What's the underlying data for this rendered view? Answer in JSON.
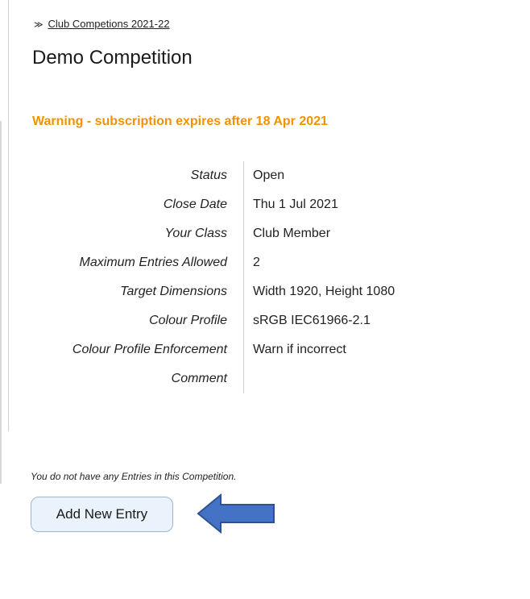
{
  "breadcrumb": {
    "chevron": "≫",
    "link_label": "Club Competions 2021-22"
  },
  "page_title": "Demo Competition",
  "warning": {
    "text": "Warning - subscription expires after 18 Apr 2021",
    "color": "#f39200"
  },
  "details": [
    {
      "label": "Status",
      "value": "Open"
    },
    {
      "label": "Close Date",
      "value": "Thu 1 Jul 2021"
    },
    {
      "label": "Your Class",
      "value": "Club Member"
    },
    {
      "label": "Maximum Entries Allowed",
      "value": "2"
    },
    {
      "label": "Target Dimensions",
      "value": "Width 1920, Height 1080"
    },
    {
      "label": "Colour Profile",
      "value": "sRGB IEC61966-2.1"
    },
    {
      "label": "Colour Profile Enforcement",
      "value": "Warn if incorrect"
    },
    {
      "label": "Comment",
      "value": ""
    }
  ],
  "entries_message": "You do not have any Entries in this Competition.",
  "add_entry_button": {
    "label": "Add New Entry"
  },
  "pointer_arrow": {
    "icon": "left-arrow-icon",
    "color": "#4472c4"
  }
}
